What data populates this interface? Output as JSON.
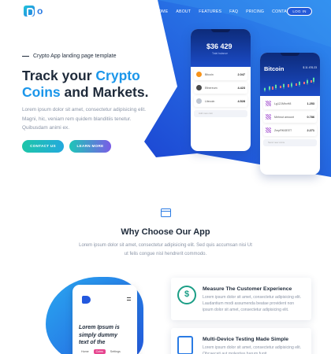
{
  "nav": {
    "logo_letter": "o",
    "menu": [
      "HOME",
      "ABOUT",
      "FEATURES",
      "FAQ",
      "PRICING",
      "CONTACT"
    ],
    "login_label": "LOG IN"
  },
  "hero": {
    "tagline": "Crypto App landing page template",
    "headline_part1": "Track your ",
    "headline_highlight1": "Crypto",
    "headline_highlight2": "Coins",
    "headline_part2": " and Markets.",
    "description": "Lorem ipsum dolor sit amet, consectetur adipisicing elit. Magni, hic, veniam rem quidem blanditiis tenetur. Quibusdam animi ex.",
    "contact_label": "CONTACT US",
    "learn_label": "LEARN MORE"
  },
  "phone1": {
    "amount": "$36 429",
    "sub": "Total balance",
    "coins": [
      {
        "name": "Bitcoin",
        "value": "2.047",
        "color": "#f7931a"
      },
      {
        "name": "Ethereum",
        "value": "4.423",
        "color": "#4a4a4a"
      },
      {
        "name": "Litecoin",
        "value": "4.528",
        "color": "#bfc6d1"
      }
    ],
    "input_placeholder": "Add new coin"
  },
  "phone2": {
    "title": "Bitcoin",
    "price": "$ 11 476.23",
    "rows": [
      {
        "name": "Lg1ZJMhvH8",
        "value": "1.253"
      },
      {
        "name": "Mehnut amount",
        "value": "0.786"
      },
      {
        "name": "ZmpRKt3EET",
        "value": "2.271"
      }
    ],
    "input_placeholder": "Send new coins"
  },
  "why": {
    "title": "Why Choose Our App",
    "description": "Lorem ipsum dolor sit amet, consectetur adipisicing elit. Sed quis accumsan nisi Ut ut felis congue nisl hendrerit commodo."
  },
  "phone3": {
    "text": "Lorem Ipsum is simply dummy text of the",
    "pills": [
      "Home",
      "Coins",
      "Settings"
    ]
  },
  "features": [
    {
      "title": "Measure The Customer Experience",
      "description": "Lorem ipsum dolor sit amet, consectetur adipisicing elit. Laudantium modi assumenda beatae provident non ipsum dolor sit amet, consectetur adipisicing elit."
    },
    {
      "title": "Multi-Device Testing Made Simple",
      "description": "Lorem ipsum dolor sit amet, consectetur adipisicing elit. Obcaecati aut molestias harum fugit."
    }
  ],
  "colors": {
    "accent": "#1b96ea",
    "hero_blue": "#2358de"
  }
}
